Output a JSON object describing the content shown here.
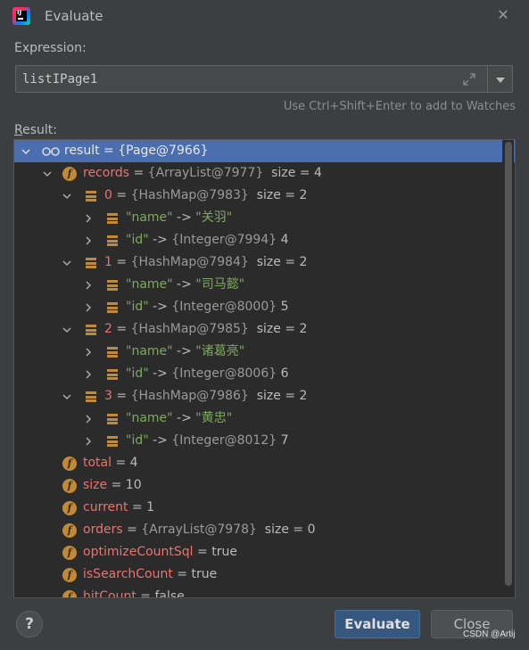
{
  "window": {
    "title": "Evaluate",
    "close_icon": "close-icon",
    "app_icon": "intellij-idea-icon"
  },
  "expression": {
    "label": "Expression:",
    "value": "listIPage1",
    "hint": "Use Ctrl+Shift+Enter to add to Watches"
  },
  "result": {
    "label_underlined": "R",
    "label_rest": "esult:",
    "rows": [
      {
        "name": "result",
        "eq": " = ",
        "value": "{Page@7966}",
        "extra": ""
      },
      {
        "name": "records",
        "eq": " = ",
        "value": "{ArrayList@7977}",
        "extra": "  size = 4"
      },
      {
        "name": "0",
        "eq": " = ",
        "value": "{HashMap@7983}",
        "extra": "  size = 2"
      },
      {
        "name": "\"name\"",
        "eq": " -> ",
        "value": "\"关羽\"",
        "extra": ""
      },
      {
        "name": "\"id\"",
        "eq": " -> ",
        "value": "{Integer@7994}",
        "extra": " 4"
      },
      {
        "name": "1",
        "eq": " = ",
        "value": "{HashMap@7984}",
        "extra": "  size = 2"
      },
      {
        "name": "\"name\"",
        "eq": " -> ",
        "value": "\"司马懿\"",
        "extra": ""
      },
      {
        "name": "\"id\"",
        "eq": " -> ",
        "value": "{Integer@8000}",
        "extra": " 5"
      },
      {
        "name": "2",
        "eq": " = ",
        "value": "{HashMap@7985}",
        "extra": "  size = 2"
      },
      {
        "name": "\"name\"",
        "eq": " -> ",
        "value": "\"诸葛亮\"",
        "extra": ""
      },
      {
        "name": "\"id\"",
        "eq": " -> ",
        "value": "{Integer@8006}",
        "extra": " 6"
      },
      {
        "name": "3",
        "eq": " = ",
        "value": "{HashMap@7986}",
        "extra": "  size = 2"
      },
      {
        "name": "\"name\"",
        "eq": " -> ",
        "value": "\"黄忠\"",
        "extra": ""
      },
      {
        "name": "\"id\"",
        "eq": " -> ",
        "value": "{Integer@8012}",
        "extra": " 7"
      },
      {
        "name": "total",
        "eq": " = ",
        "value": "4",
        "extra": ""
      },
      {
        "name": "size",
        "eq": " = ",
        "value": "10",
        "extra": ""
      },
      {
        "name": "current",
        "eq": " = ",
        "value": "1",
        "extra": ""
      },
      {
        "name": "orders",
        "eq": " = ",
        "value": "{ArrayList@7978}",
        "extra": "  size = 0"
      },
      {
        "name": "optimizeCountSql",
        "eq": " = ",
        "value": "true",
        "extra": ""
      },
      {
        "name": "isSearchCount",
        "eq": " = ",
        "value": "true",
        "extra": ""
      },
      {
        "name": "hitCount",
        "eq": " = ",
        "value": "false",
        "extra": ""
      }
    ]
  },
  "buttons": {
    "help": "?",
    "evaluate": "Evaluate",
    "close": "Close"
  },
  "watermark": "CSDN @Artij",
  "colors": {
    "accent": "#4b6eaf",
    "field": "#e8746e",
    "string": "#7fa860",
    "icon": "#c18a38"
  }
}
